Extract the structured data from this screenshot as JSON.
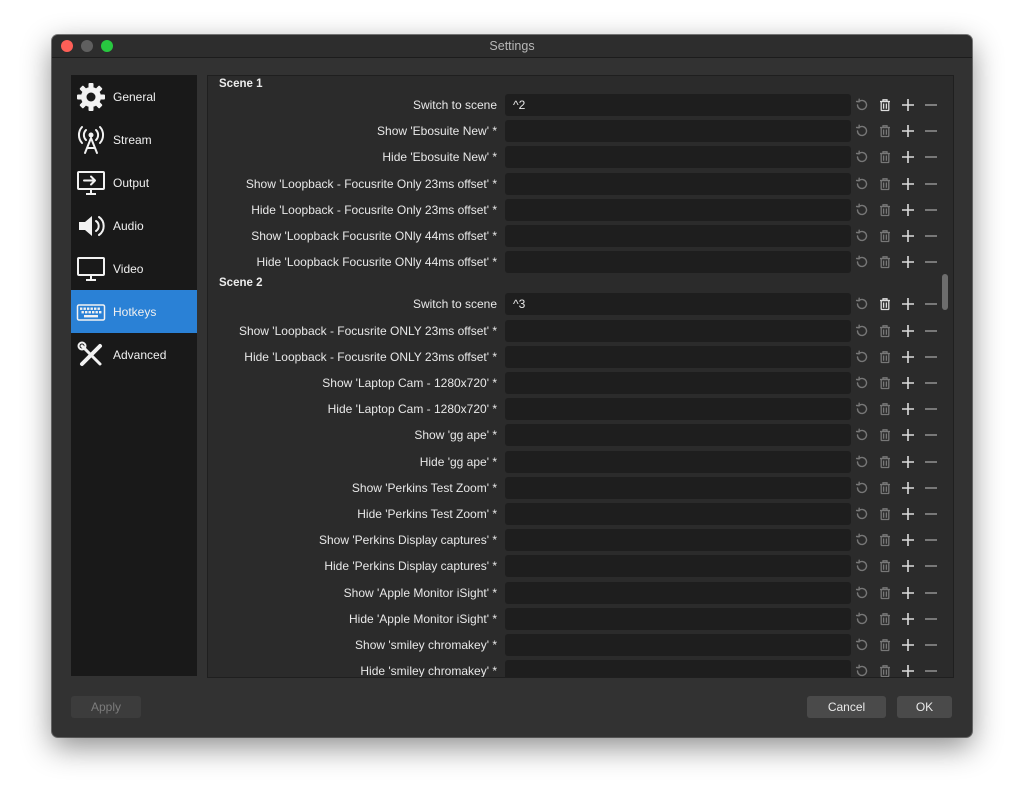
{
  "window": {
    "title": "Settings"
  },
  "sidebar": {
    "items": [
      {
        "label": "General",
        "icon": "gear-icon"
      },
      {
        "label": "Stream",
        "icon": "broadcast-antenna-icon"
      },
      {
        "label": "Output",
        "icon": "output-monitor-icon"
      },
      {
        "label": "Audio",
        "icon": "speaker-icon"
      },
      {
        "label": "Video",
        "icon": "monitor-icon"
      },
      {
        "label": "Hotkeys",
        "icon": "keyboard-icon",
        "active": true
      },
      {
        "label": "Advanced",
        "icon": "tools-icon"
      }
    ],
    "active_color": "#2a81d6"
  },
  "hotkeys": {
    "sections": [
      {
        "title": "Scene 1",
        "rows": [
          {
            "label": "Switch to scene",
            "value": "^2",
            "bound": true
          },
          {
            "label": "Show 'Ebosuite New' *",
            "value": ""
          },
          {
            "label": "Hide 'Ebosuite New' *",
            "value": ""
          },
          {
            "label": "Show 'Loopback - Focusrite Only 23ms offset' *",
            "value": ""
          },
          {
            "label": "Hide 'Loopback - Focusrite Only 23ms offset' *",
            "value": ""
          },
          {
            "label": "Show 'Loopback Focusrite ONly 44ms offset' *",
            "value": ""
          },
          {
            "label": "Hide 'Loopback Focusrite ONly 44ms offset' *",
            "value": ""
          }
        ]
      },
      {
        "title": "Scene 2",
        "rows": [
          {
            "label": "Switch to scene",
            "value": "^3",
            "bound": true
          },
          {
            "label": "Show 'Loopback - Focusrite ONLY 23ms offset' *",
            "value": ""
          },
          {
            "label": "Hide 'Loopback - Focusrite ONLY 23ms offset' *",
            "value": ""
          },
          {
            "label": "Show 'Laptop Cam - 1280x720' *",
            "value": ""
          },
          {
            "label": "Hide 'Laptop Cam - 1280x720' *",
            "value": ""
          },
          {
            "label": "Show 'gg ape' *",
            "value": ""
          },
          {
            "label": "Hide 'gg ape' *",
            "value": ""
          },
          {
            "label": "Show 'Perkins Test Zoom' *",
            "value": ""
          },
          {
            "label": "Hide 'Perkins Test Zoom' *",
            "value": ""
          },
          {
            "label": "Show 'Perkins Display captures' *",
            "value": ""
          },
          {
            "label": "Hide 'Perkins Display captures' *",
            "value": ""
          },
          {
            "label": "Show 'Apple Monitor iSight' *",
            "value": ""
          },
          {
            "label": "Hide 'Apple Monitor iSight' *",
            "value": ""
          },
          {
            "label": "Show 'smiley chromakey' *",
            "value": ""
          },
          {
            "label": "Hide 'smiley chromakey' *",
            "value": ""
          }
        ]
      }
    ]
  },
  "footer": {
    "apply": "Apply",
    "cancel": "Cancel",
    "ok": "OK"
  }
}
